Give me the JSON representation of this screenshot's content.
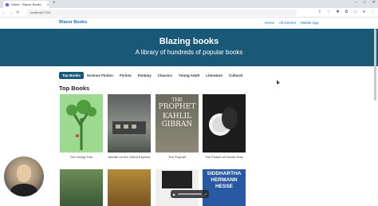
{
  "browser": {
    "tab_title": "Home - Blazor Books",
    "new_tab": "+",
    "url": "localhost:7291",
    "win_minimize": "–",
    "win_maximize": "□",
    "win_close": "✕"
  },
  "site": {
    "brand": "Blazor Books",
    "nav": [
      "Home",
      "All Genres",
      "Mobile App"
    ]
  },
  "hero": {
    "title": "Blazing books",
    "subtitle": "A library of hundreds of popular books"
  },
  "categories": [
    "Top Books",
    "Science Fiction",
    "Fiction",
    "Fantasy",
    "Classics",
    "Young Adult",
    "Literature",
    "Cultural"
  ],
  "section_title": "Top Books",
  "books": [
    {
      "title": "The Giving Tree"
    },
    {
      "title": "Murder on the Orient Express"
    },
    {
      "title": "The Prophet",
      "cover_text": [
        "THE",
        "PROPHET",
        "KAHLIL",
        "GIBRAN"
      ]
    },
    {
      "title": "The Picture of Dorian Gray"
    }
  ],
  "books_row2_cover_text": [
    "SIDDHARTHA",
    "HERMANN",
    "HESSE"
  ],
  "colors": {
    "hero_bg": "#1a5877",
    "brand": "#1b6ec2"
  }
}
